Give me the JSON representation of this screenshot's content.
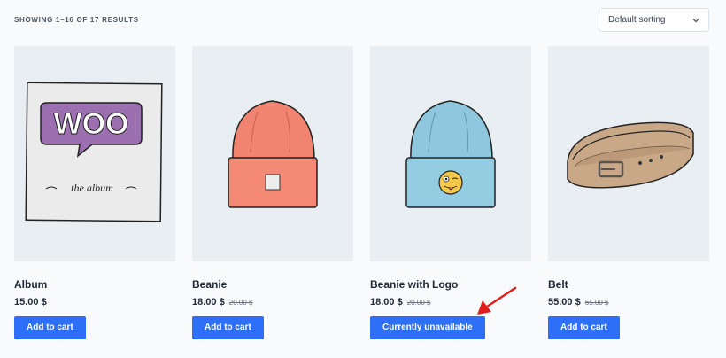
{
  "toolbar": {
    "result_count": "SHOWING 1–16 OF 17 RESULTS",
    "sorting": "Default sorting"
  },
  "products": [
    {
      "title": "Album",
      "price": "15.00 $",
      "old_price": "",
      "button": "Add to cart",
      "image_caption": "WOO",
      "image_subcaption": "the album"
    },
    {
      "title": "Beanie",
      "price": "18.00 $",
      "old_price": "20.00 $",
      "button": "Add to cart"
    },
    {
      "title": "Beanie with Logo",
      "price": "18.00 $",
      "old_price": "20.00 $",
      "button": "Currently unavailable"
    },
    {
      "title": "Belt",
      "price": "55.00 $",
      "old_price": "65.00 $",
      "button": "Add to cart"
    }
  ],
  "colors": {
    "button": "#2d6ff7",
    "annotation_arrow": "#e11d1d",
    "card_background": "#e9eef2"
  },
  "icons": [
    "chevron-down-icon",
    "red-arrow-annotation"
  ]
}
